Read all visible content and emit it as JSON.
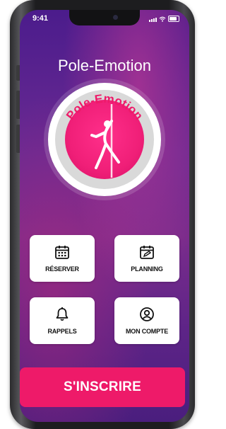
{
  "status_bar": {
    "time": "9:41"
  },
  "app": {
    "title": "Pole-Emotion",
    "logo_text": "Pole-Emotion"
  },
  "menu": [
    {
      "label": "RÉSERVER",
      "icon": "calendar-icon"
    },
    {
      "label": "PLANNING",
      "icon": "calendar-edit-icon"
    },
    {
      "label": "RAPPELS",
      "icon": "bell-icon"
    },
    {
      "label": "MON COMPTE",
      "icon": "user-circle-icon"
    }
  ],
  "cta": {
    "label": "S'INSCRIRE"
  },
  "colors": {
    "accent": "#ee1a69",
    "bg_top": "#4b1c8c",
    "bg_mid": "#7a2c8c"
  }
}
